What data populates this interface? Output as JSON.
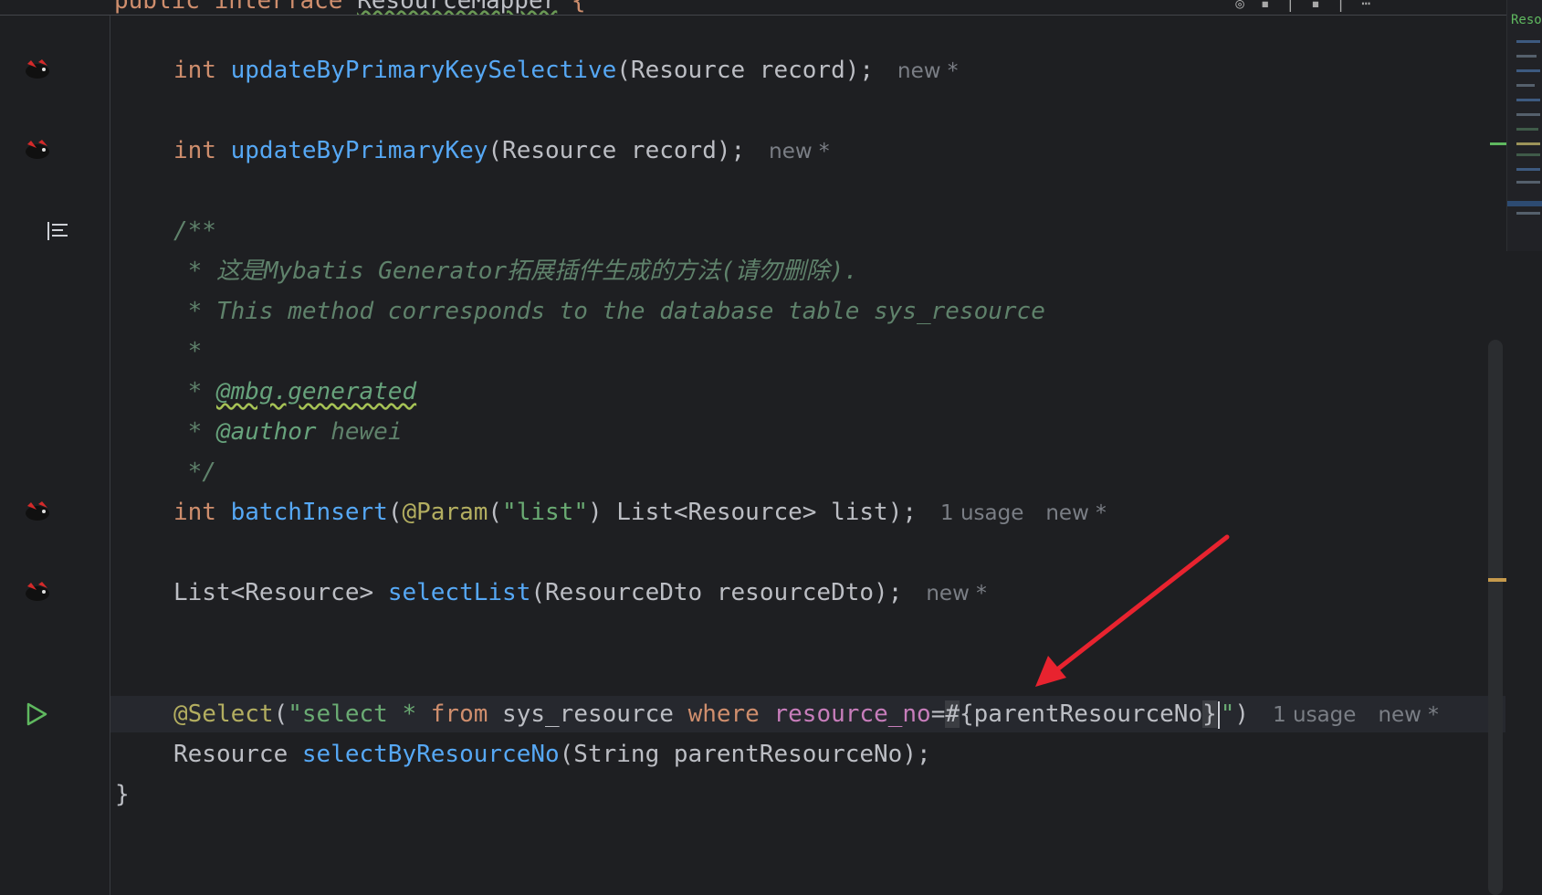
{
  "top": {
    "breadcrumb_keyword": "public interface ",
    "breadcrumb_name": "ResourceMapper",
    "breadcrumb_brace": " {"
  },
  "minimap": {
    "label": "Reso"
  },
  "code": {
    "l1": {
      "kw": "int",
      "fn": "updateByPrimaryKeySelective",
      "rest": "(Resource record);",
      "hint": "new *"
    },
    "l2": {
      "kw": "int",
      "fn": "updateByPrimaryKey",
      "rest": "(Resource record);",
      "hint": "new *"
    },
    "doc": {
      "open": "/**",
      "l1": " * 这是Mybatis Generator拓展插件生成的方法(请勿删除).",
      "l2": " * This method corresponds to the database table sys_resource",
      "l3": " *",
      "l4_prefix": " * ",
      "l4_tag": "@mbg.generated",
      "l5_prefix": " * ",
      "l5_tag": "@author",
      "l5_rest": " hewei",
      "close": " */"
    },
    "l3": {
      "kw": "int",
      "fn": "batchInsert",
      "p1": "(",
      "ann": "@Param",
      "p2": "(",
      "str": "\"list\"",
      "rest": ") List<Resource> list);",
      "usage": "1 usage",
      "hint": "new *"
    },
    "l4": {
      "type": "List<Resource> ",
      "fn": "selectList",
      "rest": "(ResourceDto resourceDto);",
      "hint": "new *"
    },
    "l5": {
      "ann": "@Select",
      "p1": "(",
      "s1": "\"select * ",
      "k1": "from",
      "s2": " sys_resource ",
      "k2": "where",
      "s3": " ",
      "col": "resource_no",
      "eq": "=",
      "hash": "#",
      "brace_open": "{",
      "param": "parentResourceNo",
      "brace_close": "}",
      "quote": "\"",
      "close": ")",
      "usage": "1 usage",
      "hint": "new *"
    },
    "l6": {
      "type": "Resource ",
      "fn": "selectByResourceNo",
      "rest": "(String parentResourceNo);"
    },
    "l7": {
      "text": "}"
    }
  },
  "colors": {
    "background": "#1e1f22",
    "keyword": "#cf8e6d",
    "function": "#56a8f5",
    "comment": "#5f826b",
    "annotation": "#b3ae60",
    "string": "#6aab73",
    "arrow": "#e8232f"
  },
  "icons": {
    "mapper_bird": "mybatis-bird-icon",
    "run": "run-play-icon",
    "doc": "rendered-doc-icon"
  }
}
